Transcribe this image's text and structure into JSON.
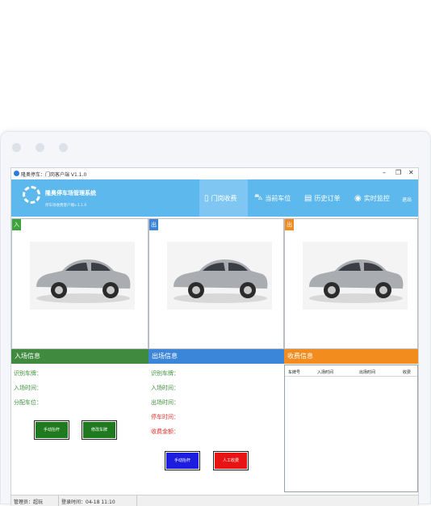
{
  "window": {
    "title": "隆奥停车：门岗客户端 V1.1.0",
    "minimize": "–",
    "restore": "❐",
    "close": "✕"
  },
  "header": {
    "app_name": "隆奥停车场管理系统",
    "app_subtitle": "停车场收费客户端v.1.1.0",
    "nav": [
      {
        "label": "门岗收费",
        "icon": "door-icon",
        "glyph": "▯"
      },
      {
        "label": "当前车位",
        "icon": "car-icon",
        "glyph": "🚘"
      },
      {
        "label": "历史订单",
        "icon": "document-icon",
        "glyph": "▤"
      },
      {
        "label": "实时监控",
        "icon": "camera-icon",
        "glyph": "📷"
      }
    ],
    "logout": "退出"
  },
  "cameras": [
    {
      "tag": "入",
      "color": "#3aa33a"
    },
    {
      "tag": "出",
      "color": "#3b86d9"
    },
    {
      "tag": "出",
      "color": "#f28c1e"
    }
  ],
  "entry": {
    "header": "入场信息",
    "header_color": "#3f8a3f",
    "plate_label": "识别车牌：",
    "time_label": "入场时间：",
    "spot_label": "分配车位：",
    "manual_btn": "手动抬杆",
    "correct_btn": "修改车牌"
  },
  "exit": {
    "header": "出场信息",
    "header_color": "#3b86d9",
    "plate_label": "识别车牌：",
    "entry_time_label": "入场时间：",
    "exit_time_label": "出场时间：",
    "duration_label": "停车时间：",
    "fee_label": "收费金额：",
    "manual_btn": "手动抬杆",
    "charge_btn": "人工收费"
  },
  "fees": {
    "header": "收费信息",
    "header_color": "#f28c1e",
    "columns": [
      "车牌号",
      "入场时间",
      "出场时间",
      "收费"
    ]
  },
  "status": {
    "operator": "管理员：超玩",
    "login_time": "登录时间：04-18 11:10"
  }
}
